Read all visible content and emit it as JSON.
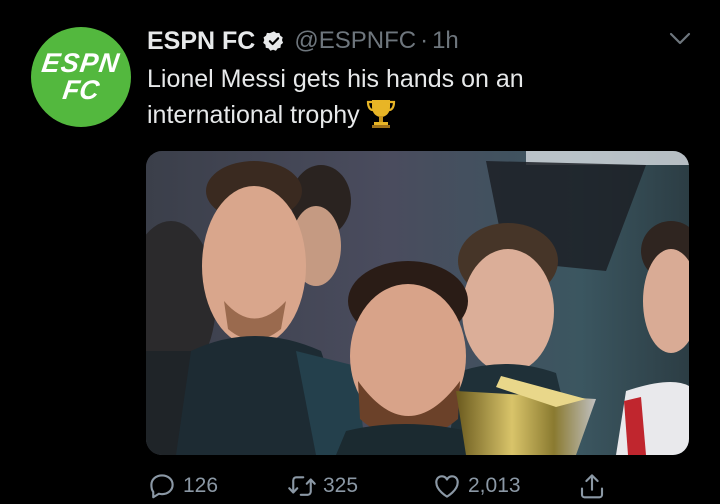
{
  "tweet": {
    "author_name": "ESPN FC",
    "handle": "@ESPNFC",
    "separator": "·",
    "time": "1h",
    "text_line1": "Lionel Messi gets his hands on an",
    "text_line2": "international trophy",
    "avatar_line1": "ESPN",
    "avatar_line2": "FC"
  },
  "actions": {
    "replies": "126",
    "retweets": "325",
    "likes": "2,013"
  },
  "icons": {
    "verified": "verified-badge-icon",
    "menu": "chevron-down-icon",
    "trophy": "trophy-emoji-icon",
    "reply": "reply-icon",
    "retweet": "retweet-icon",
    "like": "heart-icon",
    "share": "share-icon"
  },
  "colors": {
    "background": "#000000",
    "avatar_green": "#53b83e",
    "secondary_text": "#6e767d"
  }
}
